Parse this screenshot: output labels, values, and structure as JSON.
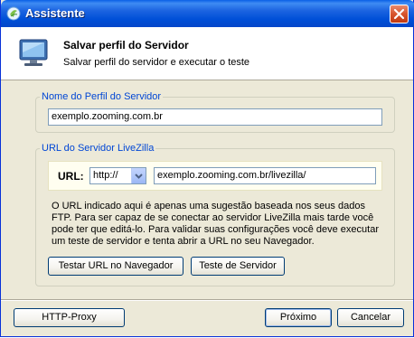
{
  "window": {
    "title": "Assistente"
  },
  "header": {
    "title": "Salvar perfil do Servidor",
    "subtitle": "Salvar perfil do servidor e executar o teste"
  },
  "profile_group": {
    "legend": "Nome do Perfil do Servidor",
    "value": "exemplo.zooming.com.br"
  },
  "url_group": {
    "legend": "URL do Servidor LiveZilla",
    "url_label": "URL:",
    "protocol": "http://",
    "url_value": "exemplo.zooming.com.br/livezilla/",
    "help_lines": [
      "O URL indicado aqui é apenas uma sugestão baseada nos seus dados",
      "FTP. Para ser capaz de se conectar ao servidor LiveZilla mais tarde você",
      "pode ter que editá-lo. Para validar suas configurações você deve executar",
      "um teste de servidor e tenta abrir a URL no seu Navegador."
    ],
    "test_url_button": "Testar URL no Navegador",
    "test_server_button": "Teste de Servidor"
  },
  "footer": {
    "proxy_button": "HTTP-Proxy",
    "next_button": "Próximo",
    "cancel_button": "Cancelar"
  }
}
